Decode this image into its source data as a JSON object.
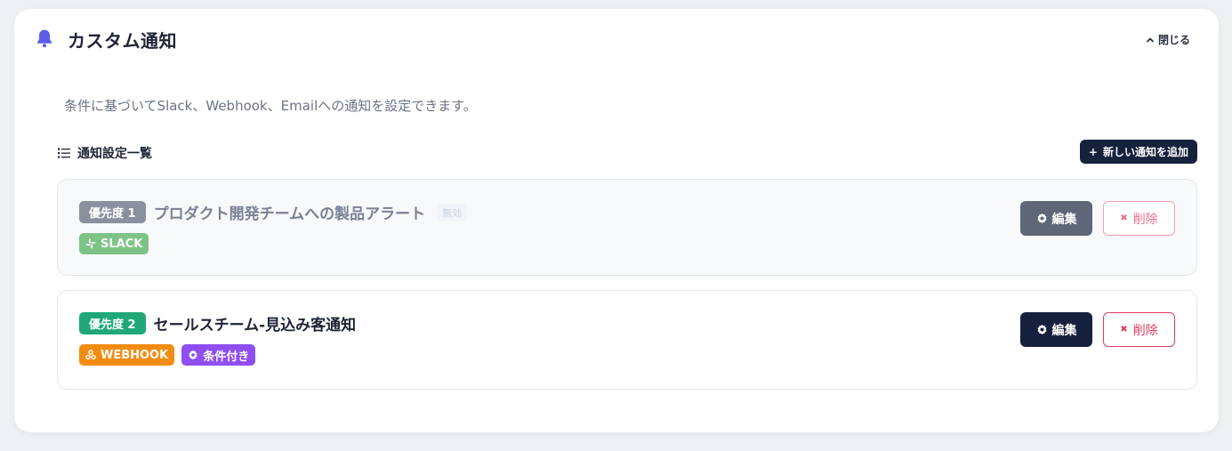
{
  "header": {
    "title": "カスタム通知",
    "close_label": "閉じる",
    "accent_color": "#5b5ee6"
  },
  "description": "条件に基づいてSlack、Webhook、Emailへの通知を設定できます。",
  "list": {
    "heading": "通知設定一覧",
    "add_button_label": "新しい通知を追加"
  },
  "notifications": [
    {
      "priority_label": "優先度 1",
      "priority_color": "#8a909e",
      "name": "プロダクト開発チームへの製品アラート",
      "status": "無効",
      "tags": [
        {
          "label": "SLACK",
          "icon": "slack-icon",
          "color": "#7dc386"
        }
      ],
      "edit_label": "編集",
      "edit_color": "#5e6678",
      "delete_label": "削除"
    },
    {
      "priority_label": "優先度 2",
      "priority_color": "#1fa876",
      "name": "セールスチーム-見込み客通知",
      "tags": [
        {
          "label": "WEBHOOK",
          "icon": "webhook-icon",
          "color": "#f28c0f"
        },
        {
          "label": "条件付き",
          "icon": "gear-icon",
          "color": "#8f4ef2"
        }
      ],
      "edit_label": "編集",
      "edit_color": "#16213d",
      "delete_label": "削除"
    }
  ]
}
